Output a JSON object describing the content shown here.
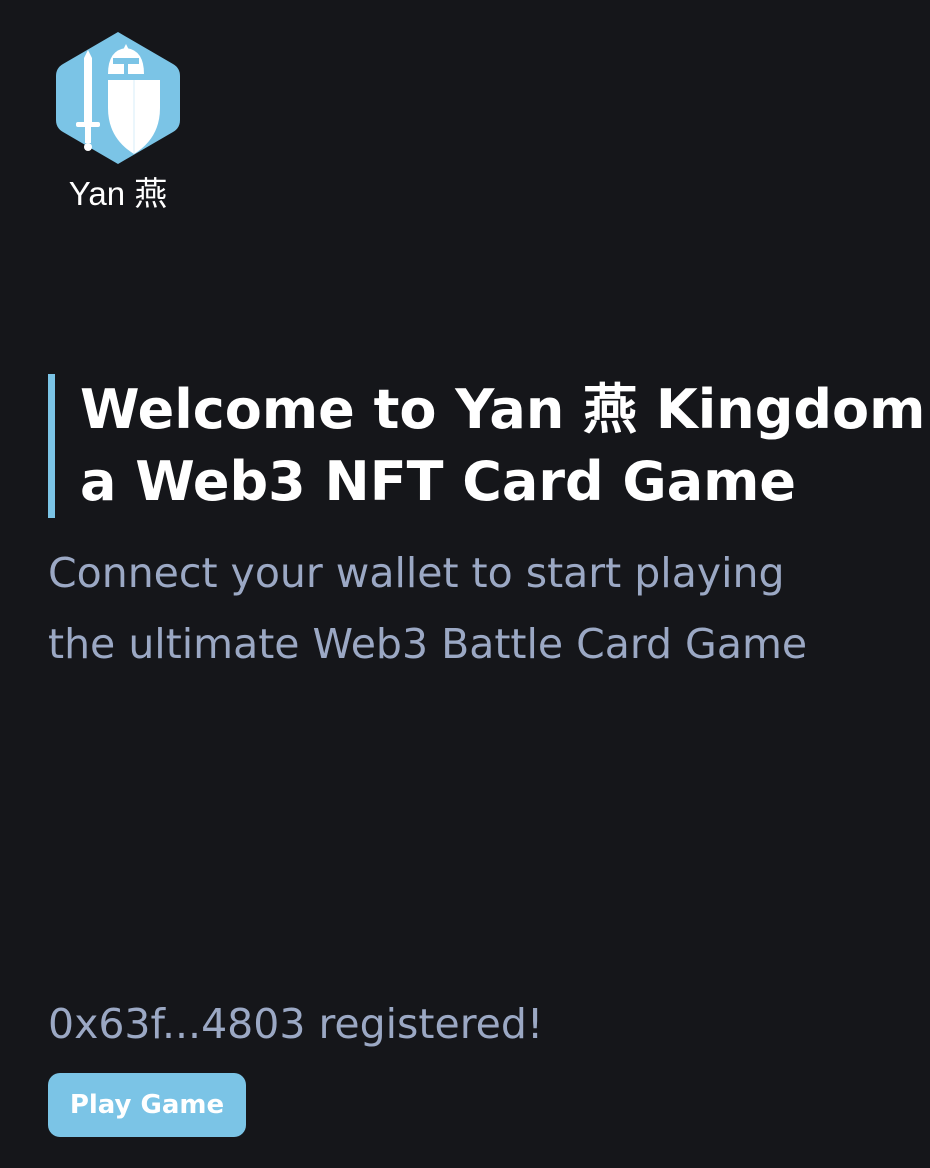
{
  "brand": {
    "name": "Yan 燕",
    "logo_icon": "knight-helmet-sword-shield-icon",
    "accent_color": "#7bc4e6"
  },
  "hero": {
    "title_line1": "Welcome to Yan 燕 Kingdom",
    "title_line2": "a Web3 NFT Card Game",
    "subtitle_line1": "Connect your wallet to start playing",
    "subtitle_line2": "the ultimate Web3 Battle Card Game"
  },
  "wallet": {
    "status_text": "0x63f...4803 registered!"
  },
  "actions": {
    "play_label": "Play Game"
  },
  "colors": {
    "background": "#15161a",
    "title_text": "#ffffff",
    "muted_text": "#9ba8c4"
  }
}
